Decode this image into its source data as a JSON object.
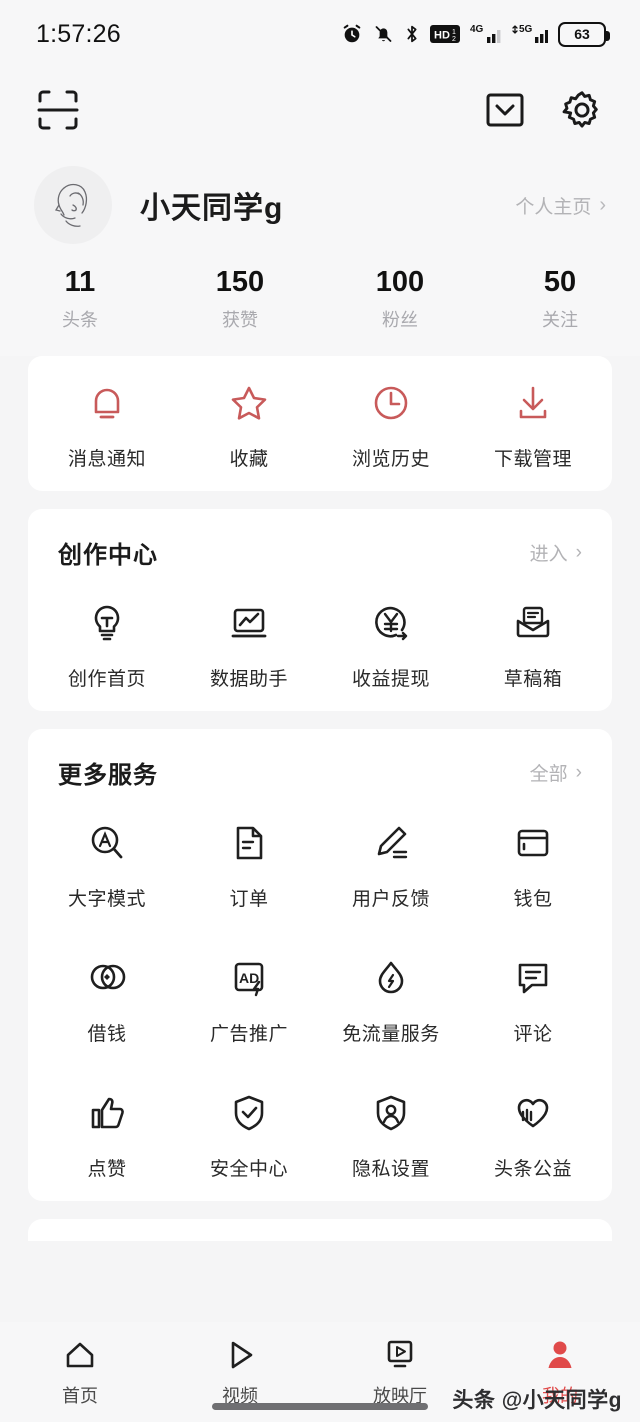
{
  "status_bar": {
    "time": "1:57:26",
    "battery_level": "63",
    "icons": [
      "alarm-icon",
      "mute-bell-icon",
      "bluetooth-icon",
      "hd-icon",
      "signal-4g-icon",
      "signal-5g-icon",
      "battery-icon"
    ]
  },
  "top_nav": {
    "scan_icon": "scan-icon",
    "inbox_icon": "inbox-icon",
    "settings_icon": "gear-icon"
  },
  "profile": {
    "avatar_icon": "avatar-portrait-icon",
    "username": "小天同学g",
    "home_link": "个人主页",
    "chevron": "›",
    "stats": [
      {
        "value": "11",
        "label": "头条"
      },
      {
        "value": "150",
        "label": "获赞"
      },
      {
        "value": "100",
        "label": "粉丝"
      },
      {
        "value": "50",
        "label": "关注"
      }
    ]
  },
  "quick_actions": {
    "items": [
      {
        "label": "消息通知",
        "icon": "bell-icon"
      },
      {
        "label": "收藏",
        "icon": "star-icon"
      },
      {
        "label": "浏览历史",
        "icon": "clock-icon"
      },
      {
        "label": "下载管理",
        "icon": "download-icon"
      }
    ]
  },
  "creation_center": {
    "title": "创作中心",
    "more_label": "进入",
    "chevron": "›",
    "items": [
      {
        "label": "创作首页",
        "icon": "lightbulb-icon"
      },
      {
        "label": "数据助手",
        "icon": "chart-laptop-icon"
      },
      {
        "label": "收益提现",
        "icon": "yen-withdraw-icon"
      },
      {
        "label": "草稿箱",
        "icon": "drafts-envelope-icon"
      }
    ]
  },
  "more_services": {
    "title": "更多服务",
    "more_label": "全部",
    "chevron": "›",
    "items": [
      {
        "label": "大字模式",
        "icon": "large-text-icon"
      },
      {
        "label": "订单",
        "icon": "order-document-icon"
      },
      {
        "label": "用户反馈",
        "icon": "feedback-pencil-icon"
      },
      {
        "label": "钱包",
        "icon": "wallet-icon"
      },
      {
        "label": "借钱",
        "icon": "borrow-money-icon"
      },
      {
        "label": "广告推广",
        "icon": "ad-promotion-icon"
      },
      {
        "label": "免流量服务",
        "icon": "free-data-drop-icon"
      },
      {
        "label": "评论",
        "icon": "comment-icon"
      },
      {
        "label": "点赞",
        "icon": "thumbs-up-icon"
      },
      {
        "label": "安全中心",
        "icon": "shield-check-icon"
      },
      {
        "label": "隐私设置",
        "icon": "shield-user-icon"
      },
      {
        "label": "头条公益",
        "icon": "charity-heart-icon"
      }
    ]
  },
  "bottom_nav": {
    "items": [
      {
        "label": "首页",
        "icon": "home-icon",
        "active": false
      },
      {
        "label": "视频",
        "icon": "play-icon",
        "active": false
      },
      {
        "label": "放映厅",
        "icon": "theater-icon",
        "active": false
      },
      {
        "label": "我的",
        "icon": "person-icon",
        "active": true
      }
    ]
  },
  "watermark": {
    "text": "头条 @小天同学g"
  },
  "colors": {
    "accent_red": "#c85a5a",
    "nav_active_red": "#e04a4a",
    "page_bg": "#f5f5f6",
    "card_bg": "#ffffff",
    "muted_text": "#b3b3b6"
  }
}
